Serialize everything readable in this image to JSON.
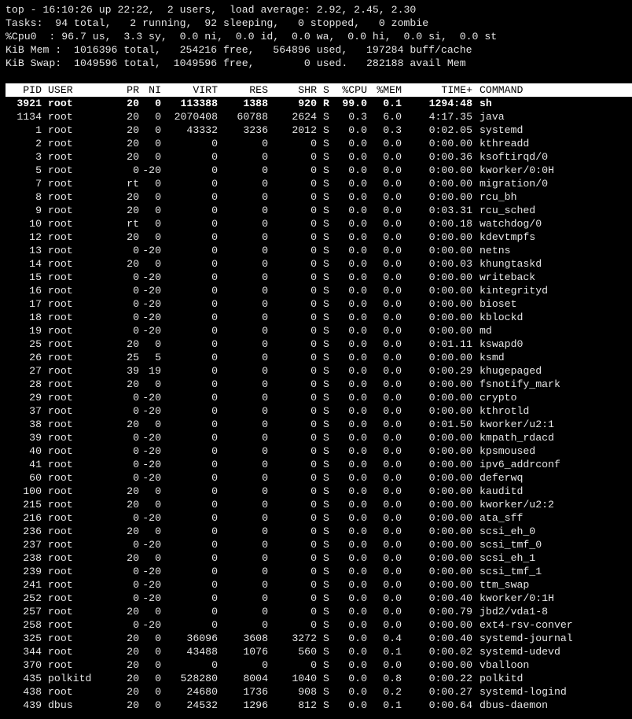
{
  "summary": {
    "line1": "top - 16:10:26 up 22:22,  2 users,  load average: 2.92, 2.45, 2.30",
    "line2": "Tasks:  94 total,   2 running,  92 sleeping,   0 stopped,   0 zombie",
    "line3": "%Cpu0  : 96.7 us,  3.3 sy,  0.0 ni,  0.0 id,  0.0 wa,  0.0 hi,  0.0 si,  0.0 st",
    "line4": "KiB Mem :  1016396 total,   254216 free,   564896 used,   197284 buff/cache",
    "line5": "KiB Swap:  1049596 total,  1049596 free,        0 used.   282188 avail Mem"
  },
  "columns": {
    "pid": "PID",
    "user": "USER",
    "pr": "PR",
    "ni": "NI",
    "virt": "VIRT",
    "res": "RES",
    "shr": "SHR",
    "s": "S",
    "cpu": "%CPU",
    "mem": "%MEM",
    "time": "TIME+",
    "command": "COMMAND"
  },
  "processes": [
    {
      "pid": "3921",
      "user": "root",
      "pr": "20",
      "ni": "0",
      "virt": "113388",
      "res": "1388",
      "shr": "920",
      "s": "R",
      "cpu": "99.0",
      "mem": "0.1",
      "time": "1294:48",
      "command": "sh",
      "bold": true
    },
    {
      "pid": "1134",
      "user": "root",
      "pr": "20",
      "ni": "0",
      "virt": "2070408",
      "res": "60788",
      "shr": "2624",
      "s": "S",
      "cpu": "0.3",
      "mem": "6.0",
      "time": "4:17.35",
      "command": "java"
    },
    {
      "pid": "1",
      "user": "root",
      "pr": "20",
      "ni": "0",
      "virt": "43332",
      "res": "3236",
      "shr": "2012",
      "s": "S",
      "cpu": "0.0",
      "mem": "0.3",
      "time": "0:02.05",
      "command": "systemd"
    },
    {
      "pid": "2",
      "user": "root",
      "pr": "20",
      "ni": "0",
      "virt": "0",
      "res": "0",
      "shr": "0",
      "s": "S",
      "cpu": "0.0",
      "mem": "0.0",
      "time": "0:00.00",
      "command": "kthreadd"
    },
    {
      "pid": "3",
      "user": "root",
      "pr": "20",
      "ni": "0",
      "virt": "0",
      "res": "0",
      "shr": "0",
      "s": "S",
      "cpu": "0.0",
      "mem": "0.0",
      "time": "0:00.36",
      "command": "ksoftirqd/0"
    },
    {
      "pid": "5",
      "user": "root",
      "pr": "0",
      "ni": "-20",
      "virt": "0",
      "res": "0",
      "shr": "0",
      "s": "S",
      "cpu": "0.0",
      "mem": "0.0",
      "time": "0:00.00",
      "command": "kworker/0:0H"
    },
    {
      "pid": "7",
      "user": "root",
      "pr": "rt",
      "ni": "0",
      "virt": "0",
      "res": "0",
      "shr": "0",
      "s": "S",
      "cpu": "0.0",
      "mem": "0.0",
      "time": "0:00.00",
      "command": "migration/0"
    },
    {
      "pid": "8",
      "user": "root",
      "pr": "20",
      "ni": "0",
      "virt": "0",
      "res": "0",
      "shr": "0",
      "s": "S",
      "cpu": "0.0",
      "mem": "0.0",
      "time": "0:00.00",
      "command": "rcu_bh"
    },
    {
      "pid": "9",
      "user": "root",
      "pr": "20",
      "ni": "0",
      "virt": "0",
      "res": "0",
      "shr": "0",
      "s": "S",
      "cpu": "0.0",
      "mem": "0.0",
      "time": "0:03.31",
      "command": "rcu_sched"
    },
    {
      "pid": "10",
      "user": "root",
      "pr": "rt",
      "ni": "0",
      "virt": "0",
      "res": "0",
      "shr": "0",
      "s": "S",
      "cpu": "0.0",
      "mem": "0.0",
      "time": "0:00.18",
      "command": "watchdog/0"
    },
    {
      "pid": "12",
      "user": "root",
      "pr": "20",
      "ni": "0",
      "virt": "0",
      "res": "0",
      "shr": "0",
      "s": "S",
      "cpu": "0.0",
      "mem": "0.0",
      "time": "0:00.00",
      "command": "kdevtmpfs"
    },
    {
      "pid": "13",
      "user": "root",
      "pr": "0",
      "ni": "-20",
      "virt": "0",
      "res": "0",
      "shr": "0",
      "s": "S",
      "cpu": "0.0",
      "mem": "0.0",
      "time": "0:00.00",
      "command": "netns"
    },
    {
      "pid": "14",
      "user": "root",
      "pr": "20",
      "ni": "0",
      "virt": "0",
      "res": "0",
      "shr": "0",
      "s": "S",
      "cpu": "0.0",
      "mem": "0.0",
      "time": "0:00.03",
      "command": "khungtaskd"
    },
    {
      "pid": "15",
      "user": "root",
      "pr": "0",
      "ni": "-20",
      "virt": "0",
      "res": "0",
      "shr": "0",
      "s": "S",
      "cpu": "0.0",
      "mem": "0.0",
      "time": "0:00.00",
      "command": "writeback"
    },
    {
      "pid": "16",
      "user": "root",
      "pr": "0",
      "ni": "-20",
      "virt": "0",
      "res": "0",
      "shr": "0",
      "s": "S",
      "cpu": "0.0",
      "mem": "0.0",
      "time": "0:00.00",
      "command": "kintegrityd"
    },
    {
      "pid": "17",
      "user": "root",
      "pr": "0",
      "ni": "-20",
      "virt": "0",
      "res": "0",
      "shr": "0",
      "s": "S",
      "cpu": "0.0",
      "mem": "0.0",
      "time": "0:00.00",
      "command": "bioset"
    },
    {
      "pid": "18",
      "user": "root",
      "pr": "0",
      "ni": "-20",
      "virt": "0",
      "res": "0",
      "shr": "0",
      "s": "S",
      "cpu": "0.0",
      "mem": "0.0",
      "time": "0:00.00",
      "command": "kblockd"
    },
    {
      "pid": "19",
      "user": "root",
      "pr": "0",
      "ni": "-20",
      "virt": "0",
      "res": "0",
      "shr": "0",
      "s": "S",
      "cpu": "0.0",
      "mem": "0.0",
      "time": "0:00.00",
      "command": "md"
    },
    {
      "pid": "25",
      "user": "root",
      "pr": "20",
      "ni": "0",
      "virt": "0",
      "res": "0",
      "shr": "0",
      "s": "S",
      "cpu": "0.0",
      "mem": "0.0",
      "time": "0:01.11",
      "command": "kswapd0"
    },
    {
      "pid": "26",
      "user": "root",
      "pr": "25",
      "ni": "5",
      "virt": "0",
      "res": "0",
      "shr": "0",
      "s": "S",
      "cpu": "0.0",
      "mem": "0.0",
      "time": "0:00.00",
      "command": "ksmd"
    },
    {
      "pid": "27",
      "user": "root",
      "pr": "39",
      "ni": "19",
      "virt": "0",
      "res": "0",
      "shr": "0",
      "s": "S",
      "cpu": "0.0",
      "mem": "0.0",
      "time": "0:00.29",
      "command": "khugepaged"
    },
    {
      "pid": "28",
      "user": "root",
      "pr": "20",
      "ni": "0",
      "virt": "0",
      "res": "0",
      "shr": "0",
      "s": "S",
      "cpu": "0.0",
      "mem": "0.0",
      "time": "0:00.00",
      "command": "fsnotify_mark"
    },
    {
      "pid": "29",
      "user": "root",
      "pr": "0",
      "ni": "-20",
      "virt": "0",
      "res": "0",
      "shr": "0",
      "s": "S",
      "cpu": "0.0",
      "mem": "0.0",
      "time": "0:00.00",
      "command": "crypto"
    },
    {
      "pid": "37",
      "user": "root",
      "pr": "0",
      "ni": "-20",
      "virt": "0",
      "res": "0",
      "shr": "0",
      "s": "S",
      "cpu": "0.0",
      "mem": "0.0",
      "time": "0:00.00",
      "command": "kthrotld"
    },
    {
      "pid": "38",
      "user": "root",
      "pr": "20",
      "ni": "0",
      "virt": "0",
      "res": "0",
      "shr": "0",
      "s": "S",
      "cpu": "0.0",
      "mem": "0.0",
      "time": "0:01.50",
      "command": "kworker/u2:1"
    },
    {
      "pid": "39",
      "user": "root",
      "pr": "0",
      "ni": "-20",
      "virt": "0",
      "res": "0",
      "shr": "0",
      "s": "S",
      "cpu": "0.0",
      "mem": "0.0",
      "time": "0:00.00",
      "command": "kmpath_rdacd"
    },
    {
      "pid": "40",
      "user": "root",
      "pr": "0",
      "ni": "-20",
      "virt": "0",
      "res": "0",
      "shr": "0",
      "s": "S",
      "cpu": "0.0",
      "mem": "0.0",
      "time": "0:00.00",
      "command": "kpsmoused"
    },
    {
      "pid": "41",
      "user": "root",
      "pr": "0",
      "ni": "-20",
      "virt": "0",
      "res": "0",
      "shr": "0",
      "s": "S",
      "cpu": "0.0",
      "mem": "0.0",
      "time": "0:00.00",
      "command": "ipv6_addrconf"
    },
    {
      "pid": "60",
      "user": "root",
      "pr": "0",
      "ni": "-20",
      "virt": "0",
      "res": "0",
      "shr": "0",
      "s": "S",
      "cpu": "0.0",
      "mem": "0.0",
      "time": "0:00.00",
      "command": "deferwq"
    },
    {
      "pid": "100",
      "user": "root",
      "pr": "20",
      "ni": "0",
      "virt": "0",
      "res": "0",
      "shr": "0",
      "s": "S",
      "cpu": "0.0",
      "mem": "0.0",
      "time": "0:00.00",
      "command": "kauditd"
    },
    {
      "pid": "215",
      "user": "root",
      "pr": "20",
      "ni": "0",
      "virt": "0",
      "res": "0",
      "shr": "0",
      "s": "S",
      "cpu": "0.0",
      "mem": "0.0",
      "time": "0:00.00",
      "command": "kworker/u2:2"
    },
    {
      "pid": "216",
      "user": "root",
      "pr": "0",
      "ni": "-20",
      "virt": "0",
      "res": "0",
      "shr": "0",
      "s": "S",
      "cpu": "0.0",
      "mem": "0.0",
      "time": "0:00.00",
      "command": "ata_sff"
    },
    {
      "pid": "236",
      "user": "root",
      "pr": "20",
      "ni": "0",
      "virt": "0",
      "res": "0",
      "shr": "0",
      "s": "S",
      "cpu": "0.0",
      "mem": "0.0",
      "time": "0:00.00",
      "command": "scsi_eh_0"
    },
    {
      "pid": "237",
      "user": "root",
      "pr": "0",
      "ni": "-20",
      "virt": "0",
      "res": "0",
      "shr": "0",
      "s": "S",
      "cpu": "0.0",
      "mem": "0.0",
      "time": "0:00.00",
      "command": "scsi_tmf_0"
    },
    {
      "pid": "238",
      "user": "root",
      "pr": "20",
      "ni": "0",
      "virt": "0",
      "res": "0",
      "shr": "0",
      "s": "S",
      "cpu": "0.0",
      "mem": "0.0",
      "time": "0:00.00",
      "command": "scsi_eh_1"
    },
    {
      "pid": "239",
      "user": "root",
      "pr": "0",
      "ni": "-20",
      "virt": "0",
      "res": "0",
      "shr": "0",
      "s": "S",
      "cpu": "0.0",
      "mem": "0.0",
      "time": "0:00.00",
      "command": "scsi_tmf_1"
    },
    {
      "pid": "241",
      "user": "root",
      "pr": "0",
      "ni": "-20",
      "virt": "0",
      "res": "0",
      "shr": "0",
      "s": "S",
      "cpu": "0.0",
      "mem": "0.0",
      "time": "0:00.00",
      "command": "ttm_swap"
    },
    {
      "pid": "252",
      "user": "root",
      "pr": "0",
      "ni": "-20",
      "virt": "0",
      "res": "0",
      "shr": "0",
      "s": "S",
      "cpu": "0.0",
      "mem": "0.0",
      "time": "0:00.40",
      "command": "kworker/0:1H"
    },
    {
      "pid": "257",
      "user": "root",
      "pr": "20",
      "ni": "0",
      "virt": "0",
      "res": "0",
      "shr": "0",
      "s": "S",
      "cpu": "0.0",
      "mem": "0.0",
      "time": "0:00.79",
      "command": "jbd2/vda1-8"
    },
    {
      "pid": "258",
      "user": "root",
      "pr": "0",
      "ni": "-20",
      "virt": "0",
      "res": "0",
      "shr": "0",
      "s": "S",
      "cpu": "0.0",
      "mem": "0.0",
      "time": "0:00.00",
      "command": "ext4-rsv-conver"
    },
    {
      "pid": "325",
      "user": "root",
      "pr": "20",
      "ni": "0",
      "virt": "36096",
      "res": "3608",
      "shr": "3272",
      "s": "S",
      "cpu": "0.0",
      "mem": "0.4",
      "time": "0:00.40",
      "command": "systemd-journal"
    },
    {
      "pid": "344",
      "user": "root",
      "pr": "20",
      "ni": "0",
      "virt": "43488",
      "res": "1076",
      "shr": "560",
      "s": "S",
      "cpu": "0.0",
      "mem": "0.1",
      "time": "0:00.02",
      "command": "systemd-udevd"
    },
    {
      "pid": "370",
      "user": "root",
      "pr": "20",
      "ni": "0",
      "virt": "0",
      "res": "0",
      "shr": "0",
      "s": "S",
      "cpu": "0.0",
      "mem": "0.0",
      "time": "0:00.00",
      "command": "vballoon"
    },
    {
      "pid": "435",
      "user": "polkitd",
      "pr": "20",
      "ni": "0",
      "virt": "528280",
      "res": "8004",
      "shr": "1040",
      "s": "S",
      "cpu": "0.0",
      "mem": "0.8",
      "time": "0:00.22",
      "command": "polkitd"
    },
    {
      "pid": "438",
      "user": "root",
      "pr": "20",
      "ni": "0",
      "virt": "24680",
      "res": "1736",
      "shr": "908",
      "s": "S",
      "cpu": "0.0",
      "mem": "0.2",
      "time": "0:00.27",
      "command": "systemd-logind"
    },
    {
      "pid": "439",
      "user": "dbus",
      "pr": "20",
      "ni": "0",
      "virt": "24532",
      "res": "1296",
      "shr": "812",
      "s": "S",
      "cpu": "0.0",
      "mem": "0.1",
      "time": "0:00.64",
      "command": "dbus-daemon"
    }
  ]
}
